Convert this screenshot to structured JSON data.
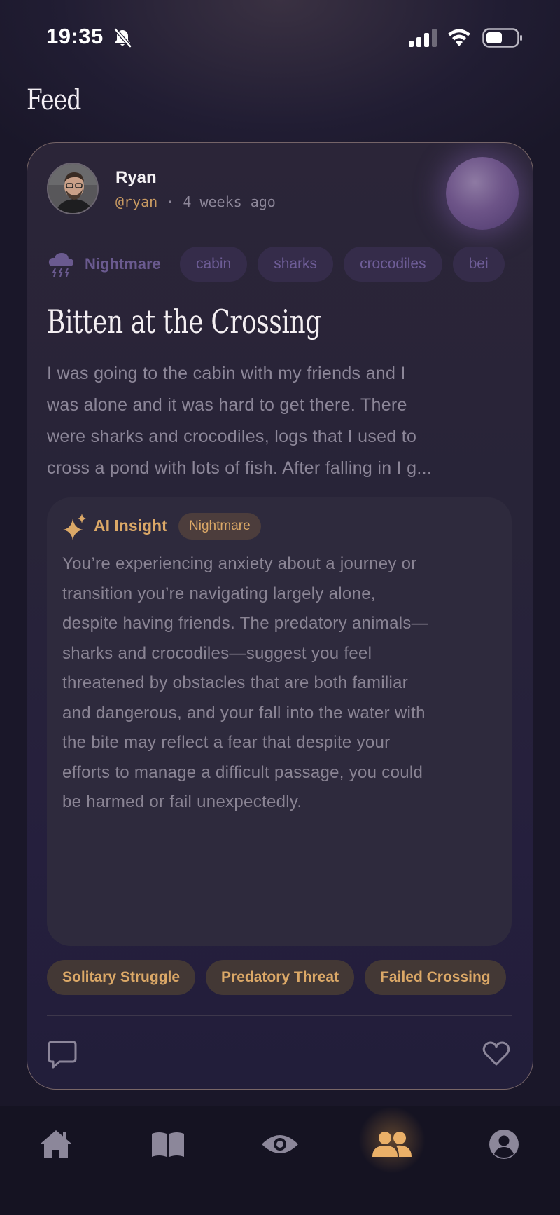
{
  "status_bar": {
    "time": "19:35",
    "icons": [
      "bell-slash-icon",
      "cellular-signal-icon",
      "wifi-icon",
      "battery-icon"
    ]
  },
  "page": {
    "title": "Feed"
  },
  "post": {
    "author": {
      "name": "Ryan",
      "handle": "@ryan",
      "time_ago": "4 weeks ago",
      "separator": "·"
    },
    "category": {
      "icon": "storm-cloud-icon",
      "label": "Nightmare"
    },
    "tags": [
      "cabin",
      "sharks",
      "crocodiles",
      "bei"
    ],
    "title": "Bitten at the Crossing",
    "body_lines": [
      "I was going to the cabin with my friends and I",
      "was alone and it was hard to get there. There",
      "were sharks and crocodiles, logs that I used to",
      "cross a pond with lots of fish. After falling in I g..."
    ],
    "insight": {
      "label": "AI Insight",
      "badge": "Nightmare",
      "text_lines": [
        "You’re experiencing anxiety about a journey or",
        "transition you’re navigating largely alone,",
        "despite having friends. The predatory animals—",
        "sharks and crocodiles—suggest you feel",
        "threatened by obstacles that are both familiar",
        "and dangerous, and your fall into the water with",
        "the bite may reflect a fear that despite your",
        "efforts to manage a difficult passage, you could",
        "be harmed or fail unexpectedly."
      ]
    },
    "themes": [
      "Solitary Struggle",
      "Predatory Threat",
      "Failed Crossing"
    ],
    "actions": {
      "comment_icon": "comment-icon",
      "like_icon": "heart-icon"
    }
  },
  "tab_bar": {
    "tabs": [
      {
        "name": "home",
        "icon": "home-icon",
        "active": false
      },
      {
        "name": "journal",
        "icon": "book-icon",
        "active": false
      },
      {
        "name": "insights",
        "icon": "eye-icon",
        "active": false
      },
      {
        "name": "community",
        "icon": "people-icon",
        "active": true
      },
      {
        "name": "profile",
        "icon": "user-circle-icon",
        "active": false
      }
    ]
  },
  "colors": {
    "accent": "#dba867",
    "muted_purple": "#6e5d97",
    "background": "#1a1729",
    "card": "#282438"
  }
}
